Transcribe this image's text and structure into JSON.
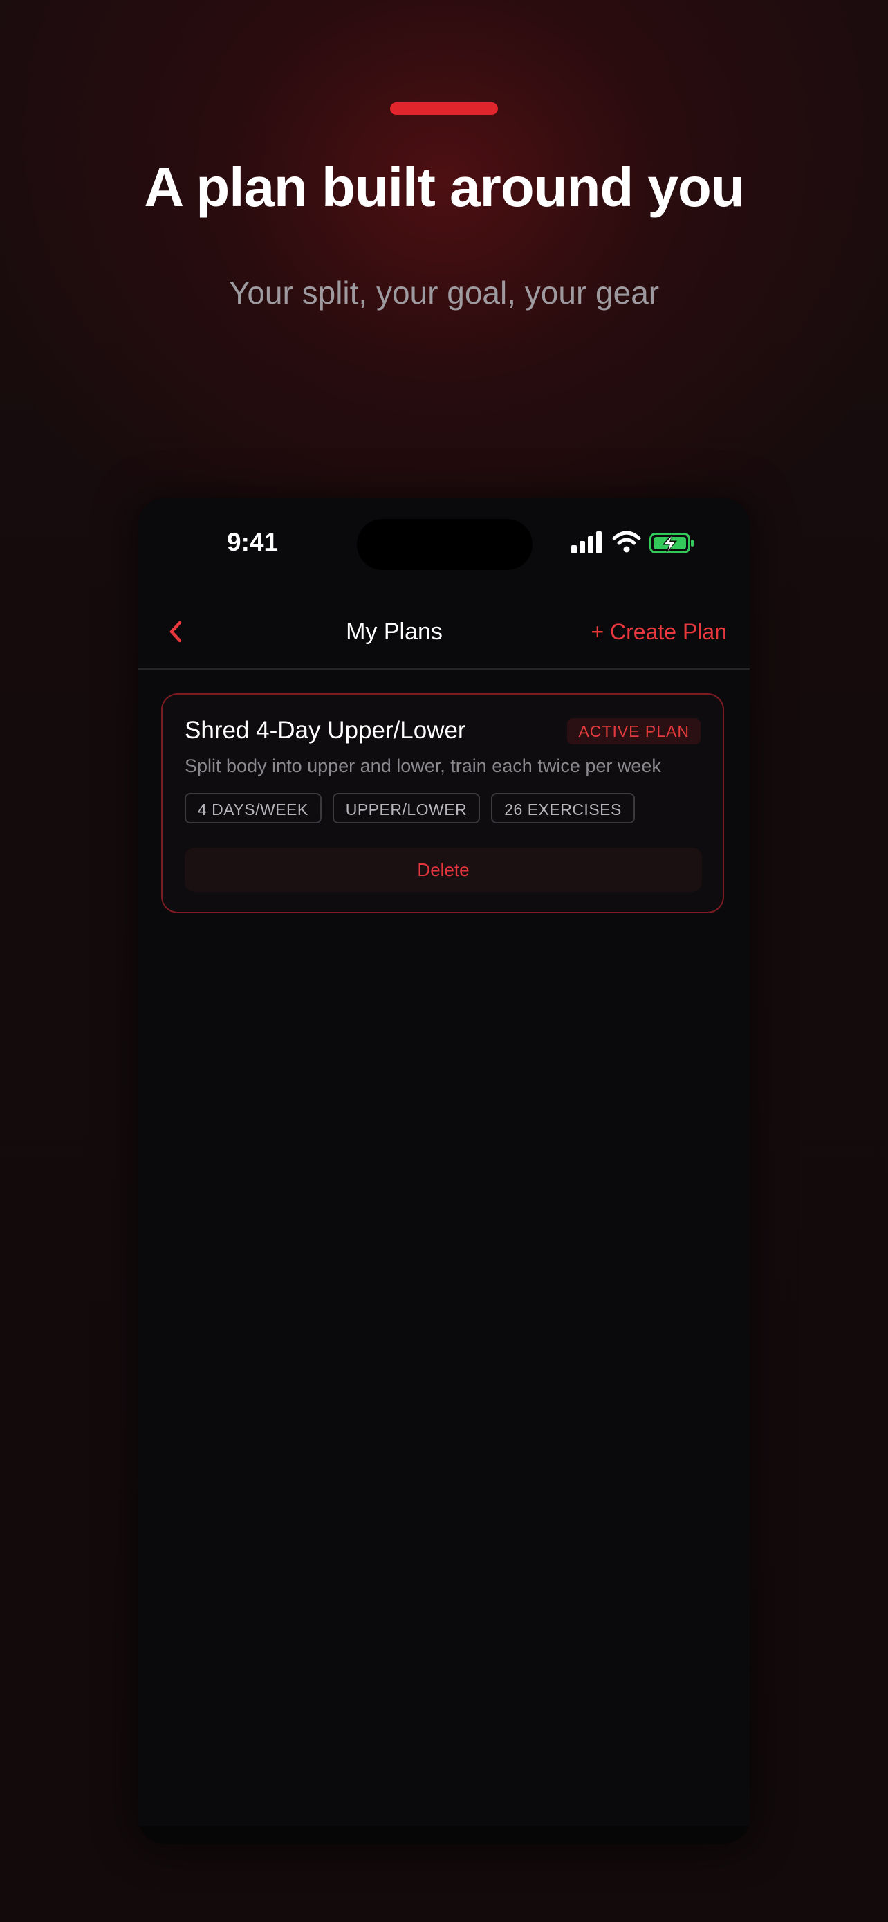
{
  "hero": {
    "headline": "A plan built around you",
    "subhead": "Your split, your goal, your gear"
  },
  "status_bar": {
    "time": "9:41",
    "icons": [
      "cellular-signal-icon",
      "wifi-icon",
      "battery-charging-icon"
    ]
  },
  "nav": {
    "back_icon": "chevron-left-icon",
    "title": "My Plans",
    "create_label": "+ Create Plan"
  },
  "plans": [
    {
      "title": "Shred 4-Day Upper/Lower",
      "badge": "ACTIVE PLAN",
      "description": "Split body into upper and lower, train each twice per week",
      "tags": [
        "4 DAYS/WEEK",
        "UPPER/LOWER",
        "26 EXERCISES"
      ],
      "delete_label": "Delete"
    }
  ],
  "colors": {
    "accent": "#e0262c",
    "background": "#120a0b",
    "phone_background": "#0a0a0c",
    "battery": "#34c759"
  }
}
